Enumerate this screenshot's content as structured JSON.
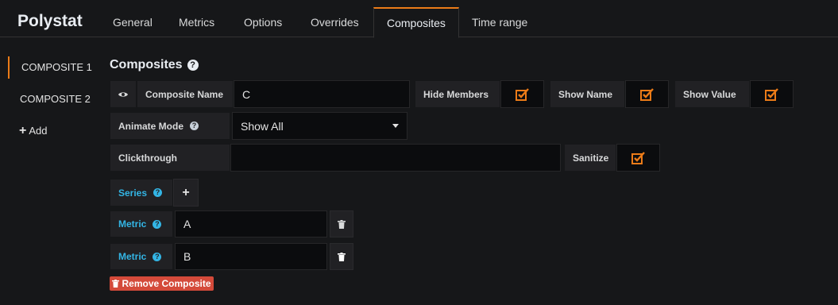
{
  "app": {
    "title": "Polystat"
  },
  "tabs": [
    {
      "label": "General"
    },
    {
      "label": "Metrics"
    },
    {
      "label": "Options"
    },
    {
      "label": "Overrides"
    },
    {
      "label": "Composites",
      "active": true
    },
    {
      "label": "Time range"
    }
  ],
  "sidebar": {
    "items": [
      {
        "label": "COMPOSITE 1",
        "active": true
      },
      {
        "label": "COMPOSITE 2"
      }
    ],
    "add_label": "Add"
  },
  "composites": {
    "section_title": "Composites",
    "composite_name_label": "Composite Name",
    "composite_name_value": "C",
    "hide_members_label": "Hide Members",
    "hide_members_checked": true,
    "show_name_label": "Show Name",
    "show_name_checked": true,
    "show_value_label": "Show Value",
    "show_value_checked": true,
    "animate_mode_label": "Animate Mode",
    "animate_mode_value": "Show All",
    "clickthrough_label": "Clickthrough",
    "clickthrough_value": "",
    "sanitize_label": "Sanitize",
    "sanitize_checked": true,
    "series_label": "Series",
    "metric_label": "Metric",
    "metrics": [
      {
        "value": "A"
      },
      {
        "value": "B"
      }
    ],
    "remove_label": "Remove Composite"
  },
  "colors": {
    "accent": "#eb7b18",
    "link_blue": "#33b5e5",
    "danger": "#d44a3a"
  },
  "icons": [
    "eye-icon",
    "help-icon",
    "checkbox-checked-icon",
    "plus-icon",
    "trash-icon",
    "caret-down-icon"
  ]
}
